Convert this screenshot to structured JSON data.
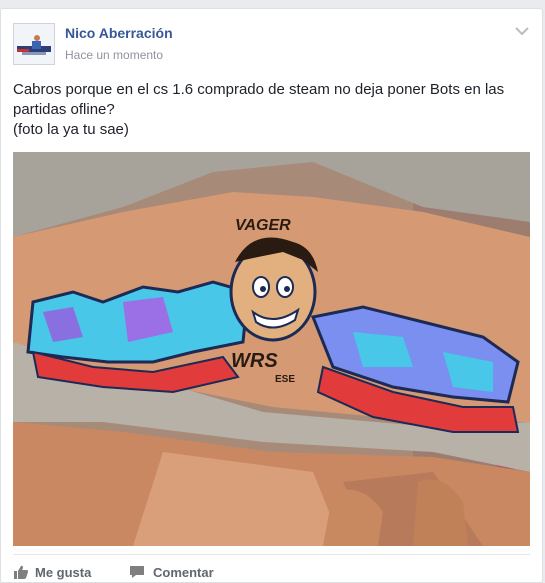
{
  "post": {
    "author": "Nico Aberración",
    "timestamp": "Hace un momento",
    "message_lines": [
      "Cabros porque en el cs 1.6 comprado de steam no deja poner Bots en las",
      "partidas ofline?",
      "(foto la ya tu sae)"
    ],
    "photo_text": {
      "tag_top": "VAGER",
      "tag_bottom": "WRS",
      "tag_bottom_small": "ESE"
    }
  },
  "actions": {
    "like_label": "Me gusta",
    "comment_label": "Comentar"
  },
  "colors": {
    "link": "#365899",
    "meta": "#90949c",
    "text": "#1d2129",
    "action": "#616770"
  },
  "icons": {
    "options": "chevron-down-icon",
    "like": "thumbs-up-icon",
    "comment": "comment-bubble-icon"
  }
}
